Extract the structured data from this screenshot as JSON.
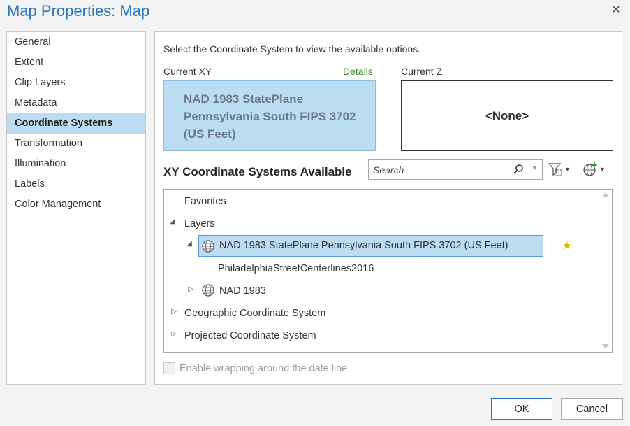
{
  "window": {
    "title": "Map Properties: Map"
  },
  "nav": {
    "items": [
      {
        "label": "General"
      },
      {
        "label": "Extent"
      },
      {
        "label": "Clip Layers"
      },
      {
        "label": "Metadata"
      },
      {
        "label": "Coordinate Systems",
        "active": true
      },
      {
        "label": "Transformation"
      },
      {
        "label": "Illumination"
      },
      {
        "label": "Labels"
      },
      {
        "label": "Color Management"
      }
    ]
  },
  "main": {
    "intro": "Select the Coordinate System to view the available options.",
    "current_xy_label": "Current XY",
    "details_link": "Details",
    "current_xy_value": "NAD 1983 StatePlane Pennsylvania South FIPS 3702 (US Feet)",
    "current_z_label": "Current Z",
    "current_z_value": "<None>",
    "available_heading": "XY Coordinate Systems Available",
    "search": {
      "placeholder": "Search"
    },
    "tree": {
      "favorites": "Favorites",
      "layers": "Layers",
      "selected_cs": "NAD 1983 StatePlane Pennsylvania South FIPS 3702 (US Feet)",
      "layer_name": "PhiladelphiaStreetCenterlines2016",
      "nad1983": "NAD 1983",
      "geographic": "Geographic Coordinate System",
      "projected": "Projected Coordinate System"
    },
    "wrap_label": "Enable wrapping around the date line",
    "wrap_checked": false
  },
  "footer": {
    "ok_label": "OK",
    "cancel_label": "Cancel"
  },
  "colors": {
    "accent": "#2a74b8",
    "selection": "#bcdcf2",
    "link": "#3d8a2b"
  }
}
